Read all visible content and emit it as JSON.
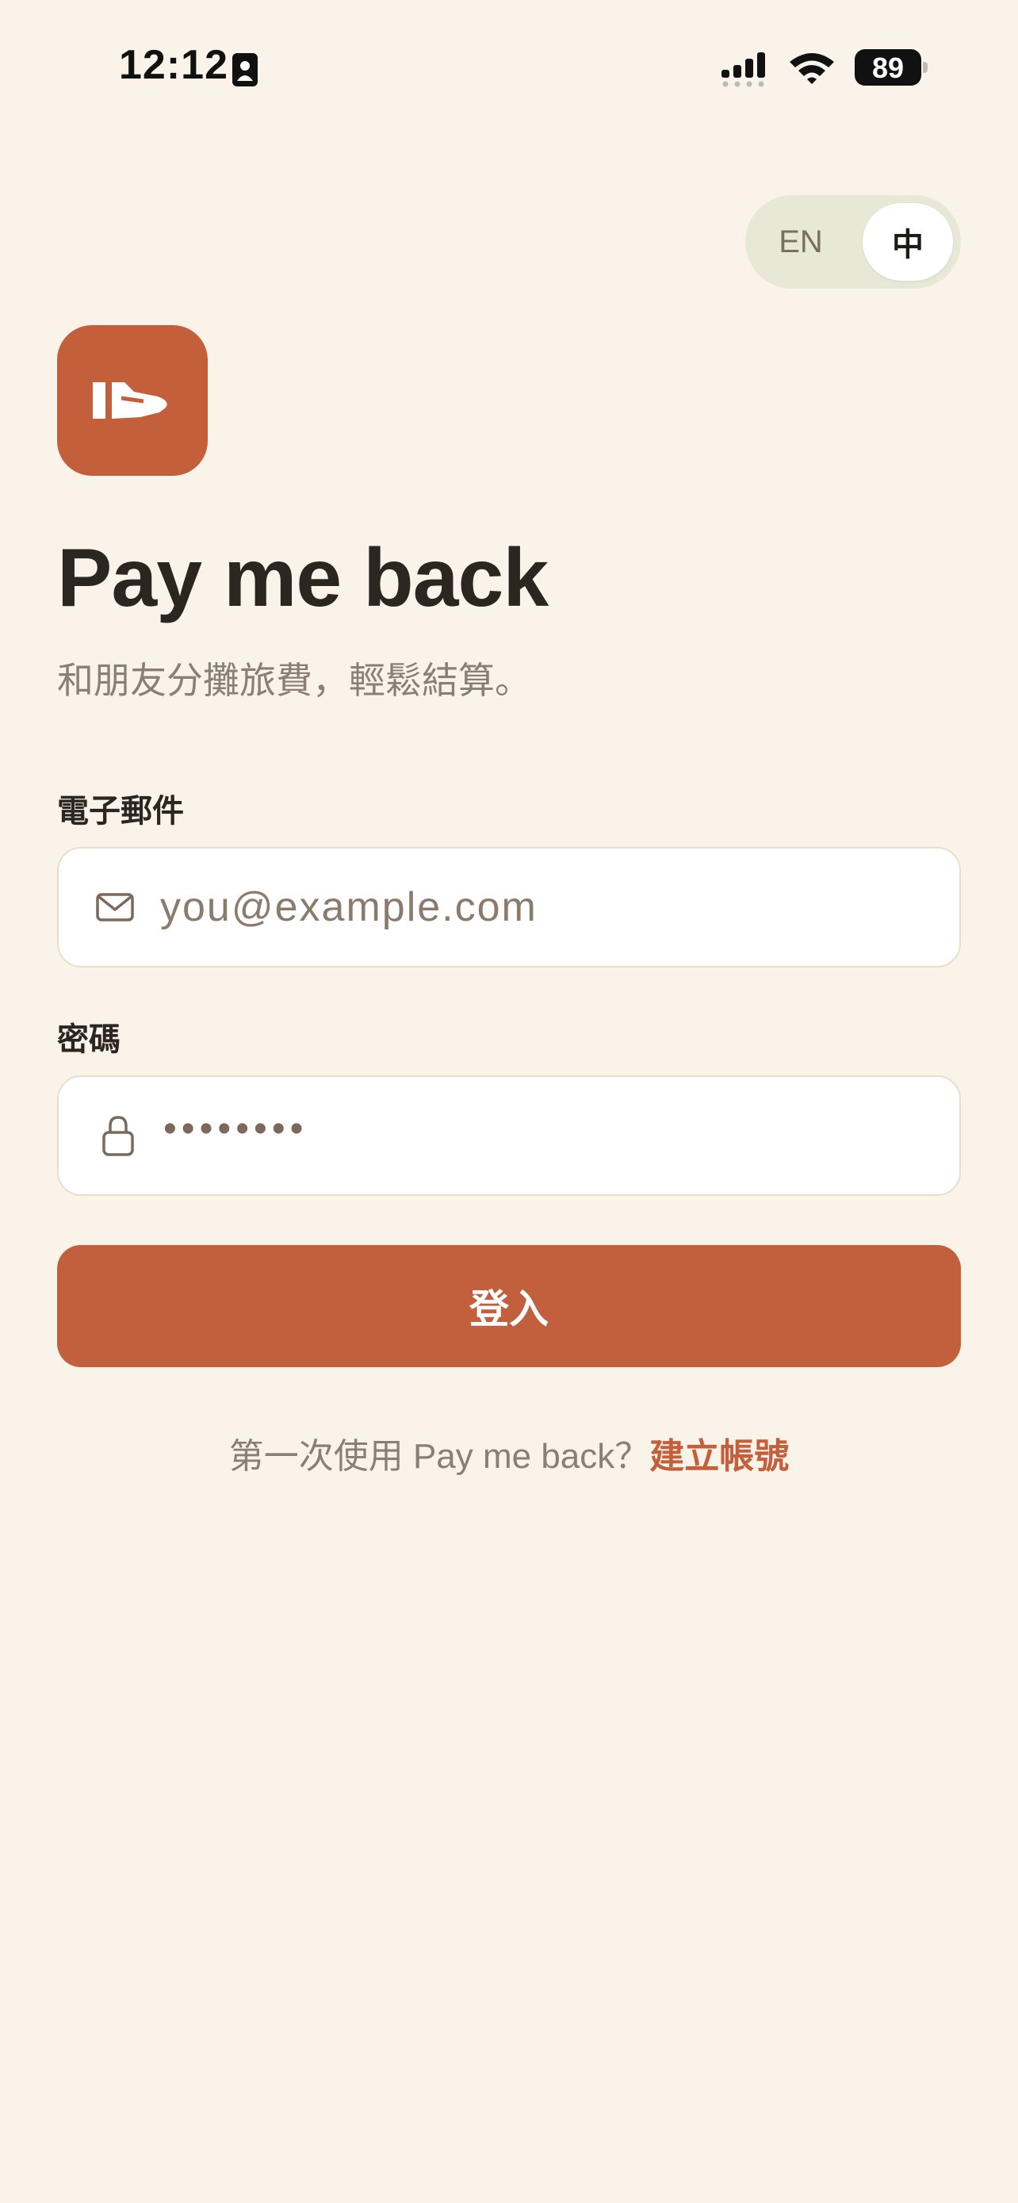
{
  "status_bar": {
    "time": "12:12",
    "battery": "89"
  },
  "language_toggle": {
    "options": [
      "EN",
      "中"
    ],
    "selected": "中"
  },
  "app": {
    "logo_icon": "hand-receive-icon",
    "title": "Pay me back",
    "subtitle": "和朋友分攤旅費，輕鬆結算。"
  },
  "form": {
    "email": {
      "label": "電子郵件",
      "placeholder": "you@example.com",
      "icon": "mail-icon"
    },
    "password": {
      "label": "密碼",
      "value_masked": "••••••••",
      "icon": "lock-icon"
    },
    "submit_label": "登入"
  },
  "footer": {
    "prompt": "第一次使用 Pay me back？",
    "link_label": "建立帳號"
  },
  "colors": {
    "background": "#FAF3EA",
    "accent": "#C45F3B",
    "toggle_bg": "#E8E8D7",
    "text_primary": "#2B261F",
    "text_muted": "#8A7F73"
  }
}
